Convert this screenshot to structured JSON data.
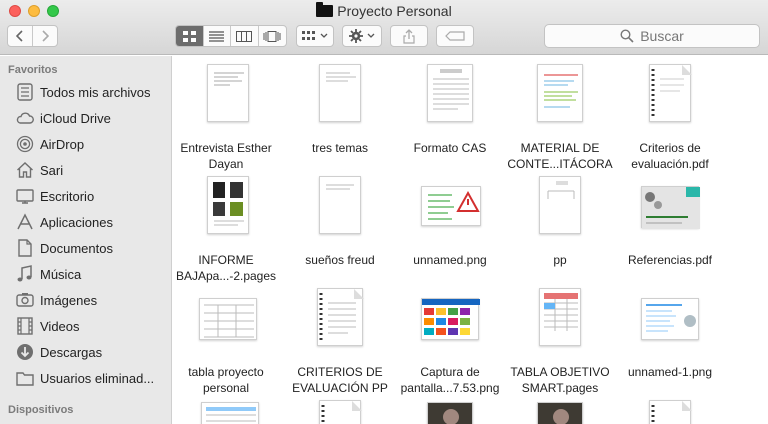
{
  "window": {
    "title": "Proyecto Personal"
  },
  "toolbar": {
    "search_placeholder": "Buscar"
  },
  "sidebar": {
    "favorites_header": "Favoritos",
    "devices_header": "Dispositivos",
    "items": [
      {
        "label": "Todos mis archivos",
        "icon": "all-files-icon"
      },
      {
        "label": "iCloud Drive",
        "icon": "cloud-icon"
      },
      {
        "label": "AirDrop",
        "icon": "airdrop-icon"
      },
      {
        "label": "Sari",
        "icon": "home-icon"
      },
      {
        "label": "Escritorio",
        "icon": "desktop-folder-icon"
      },
      {
        "label": "Aplicaciones",
        "icon": "applications-icon"
      },
      {
        "label": "Documentos",
        "icon": "documents-icon"
      },
      {
        "label": "Música",
        "icon": "music-icon"
      },
      {
        "label": "Imágenes",
        "icon": "camera-icon"
      },
      {
        "label": "Videos",
        "icon": "film-icon"
      },
      {
        "label": "Descargas",
        "icon": "download-icon"
      },
      {
        "label": "Usuarios eliminad...",
        "icon": "folder-icon"
      }
    ]
  },
  "files": [
    {
      "line1": "Entrevista Esther",
      "line2": "Dayan",
      "kind": "doc"
    },
    {
      "line1": "tres temas",
      "line2": "",
      "kind": "doc"
    },
    {
      "line1": "Formato CAS",
      "line2": "",
      "kind": "doc"
    },
    {
      "line1": "MATERIAL DE",
      "line2": "CONTE...ITÁCORA",
      "kind": "doc"
    },
    {
      "line1": "Criterios de",
      "line2": "evaluación.pdf",
      "kind": "pdf"
    },
    {
      "line1": "INFORME",
      "line2": "BAJApa...-2.pages",
      "kind": "doc"
    },
    {
      "line1": "sueños freud",
      "line2": "",
      "kind": "doc"
    },
    {
      "line1": "unnamed.png",
      "line2": "",
      "kind": "image"
    },
    {
      "line1": "pp",
      "line2": "",
      "kind": "doc"
    },
    {
      "line1": "Referencias.pdf",
      "line2": "",
      "kind": "image"
    },
    {
      "line1": "tabla proyecto",
      "line2": "personal",
      "kind": "table"
    },
    {
      "line1": "CRITERIOS DE",
      "line2": "EVALUACIÓN PP",
      "kind": "pdf"
    },
    {
      "line1": "Captura de",
      "line2": "pantalla...7.53.png",
      "kind": "image"
    },
    {
      "line1": "TABLA OBJETIVO",
      "line2": "SMART.pages",
      "kind": "doc"
    },
    {
      "line1": "unnamed-1.png",
      "line2": "",
      "kind": "image"
    }
  ]
}
